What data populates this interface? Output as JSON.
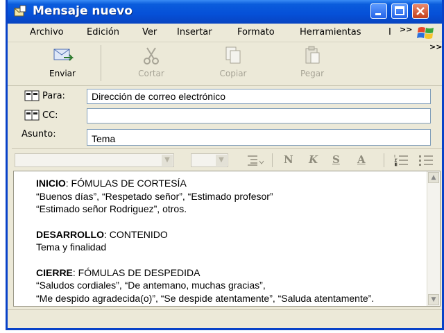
{
  "window": {
    "title": "Mensaje nuevo"
  },
  "menu": {
    "items": [
      "Archivo",
      "Edición",
      "Ver",
      "Insertar",
      "Formato",
      "Herramientas",
      "I"
    ],
    "overflow": ">>"
  },
  "toolbar": {
    "send": "Enviar",
    "cut": "Cortar",
    "copy": "Copiar",
    "paste": "Pegar",
    "overflow": ">>"
  },
  "header": {
    "to_label": "Para:",
    "cc_label": "CC:",
    "subject_label": "Asunto:",
    "to_value": "Dirección de correo electrónico",
    "cc_value": "",
    "subject_value": "Tema"
  },
  "format": {
    "bold": "N",
    "italic": "K",
    "underline": "S",
    "color": "A"
  },
  "body": {
    "inicio_head": "INICIO",
    "inicio_rest": ": FÓMULAS DE CORTESÍA",
    "inicio_line1": "“Buenos días”, “Respetado señor”, “Estimado profesor”",
    "inicio_line2": "“Estimado señor Rodriguez”, otros.",
    "desarrollo_head": "DESARROLLO",
    "desarrollo_rest": ": CONTENIDO",
    "desarrollo_line1": "Tema y finalidad",
    "cierre_head": "CIERRE",
    "cierre_rest": ": FÓMULAS DE DESPEDIDA",
    "cierre_line1": "“Saludos cordiales”, “De antemano, muchas gracias”,",
    "cierre_line2": "“Me despido agradecida(o)”, “Se despide atentamente”, “Saluda atentamente”."
  },
  "colors": {
    "titlebar": "#0650d8",
    "chrome": "#ece9d8",
    "field_border": "#7f9db9"
  }
}
